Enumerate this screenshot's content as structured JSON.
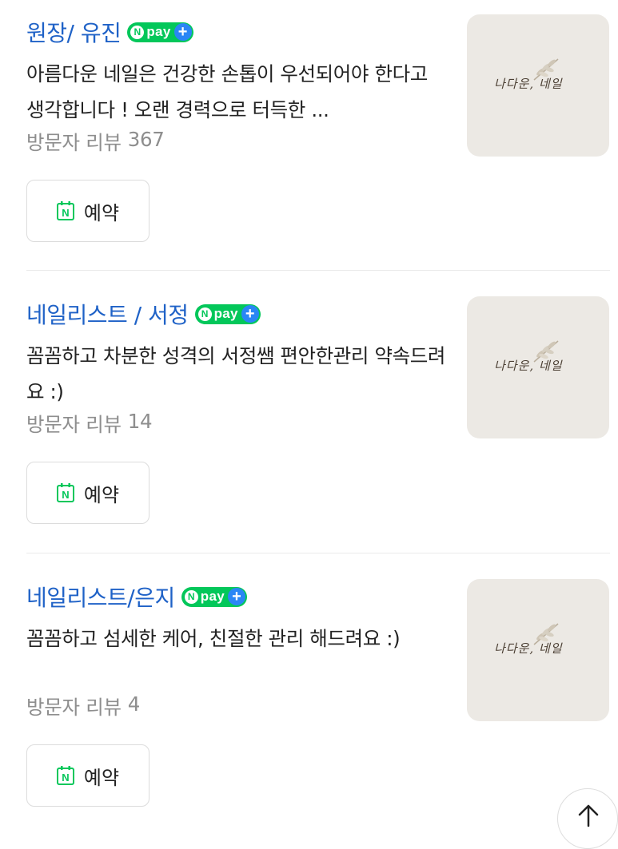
{
  "items": [
    {
      "title": "원장/ 유진",
      "npay": {
        "n": "N",
        "text": "pay",
        "plus": "+"
      },
      "desc": "아름다운 네일은 건강한 손톱이 우선되어야 한다고 생각합니다 ! 오랜 경력으로 터득한 ...",
      "reviews_label": "방문자 리뷰",
      "reviews_count": "367",
      "thumb_logo": "나다운, 네일",
      "book_label": "예약",
      "book_icon": "N"
    },
    {
      "title": "네일리스트 / 서정",
      "npay": {
        "n": "N",
        "text": "pay",
        "plus": "+"
      },
      "desc": "꼼꼼하고 차분한 성격의 서정쌤 편안한관리 약속드려요 :)",
      "reviews_label": "방문자 리뷰",
      "reviews_count": "14",
      "thumb_logo": "나다운, 네일",
      "book_label": "예약",
      "book_icon": "N"
    },
    {
      "title": "네일리스트/은지",
      "npay": {
        "n": "N",
        "text": "pay",
        "plus": "+"
      },
      "desc": "꼼꼼하고 섬세한 케어, 친절한 관리 해드려요 :)",
      "reviews_label": "방문자 리뷰",
      "reviews_count": "4",
      "thumb_logo": "나다운, 네일",
      "book_label": "예약",
      "book_icon": "N"
    }
  ],
  "scroll_top_icon": "arrow-up-icon",
  "colors": {
    "title": "#1f62c7",
    "npay_green": "#03c75a",
    "npay_blue": "#2a86f5",
    "review_gray": "#8e8e8e",
    "naver_book_green": "#03c75a"
  }
}
